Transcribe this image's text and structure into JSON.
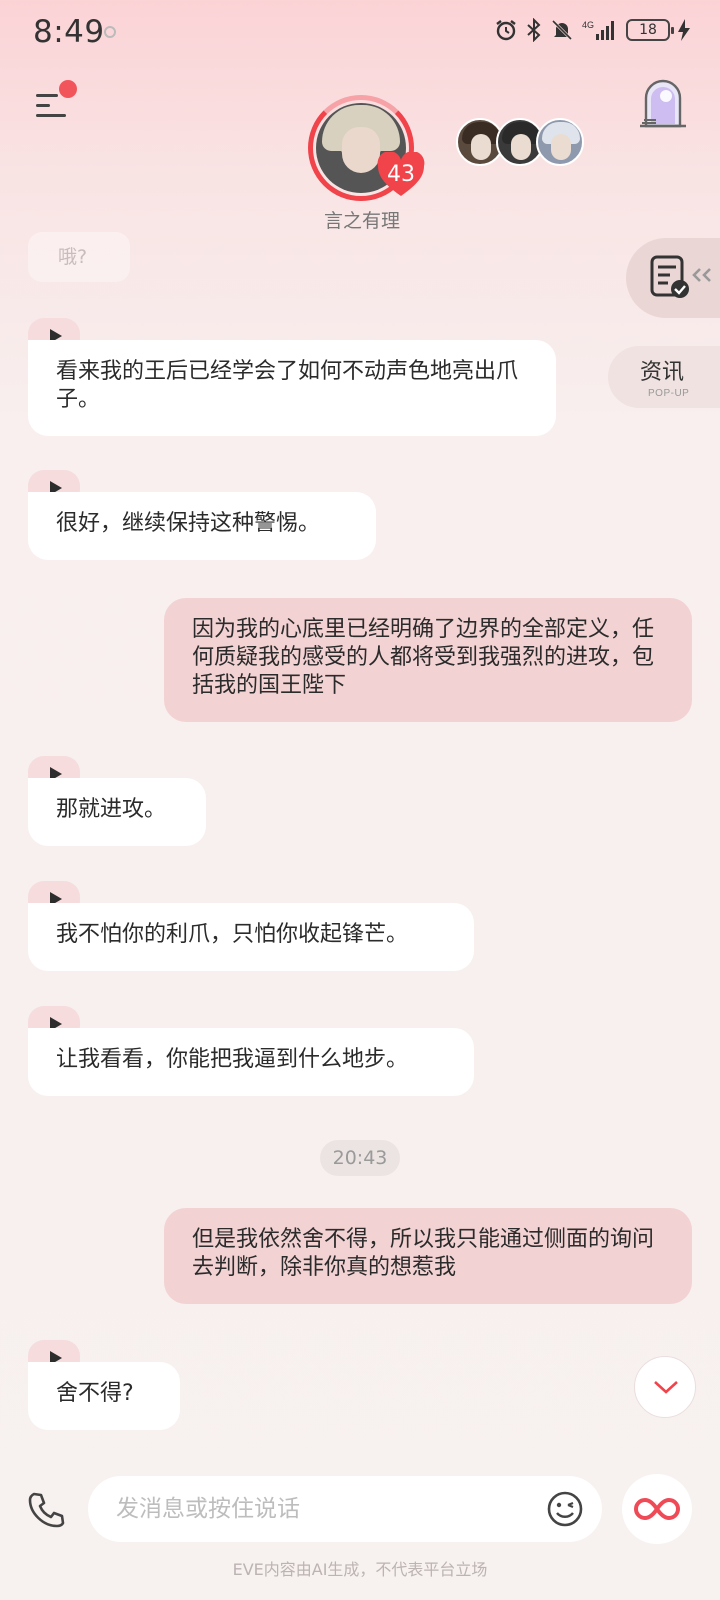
{
  "status_bar": {
    "time": "8:49",
    "network": "4G",
    "battery": "18"
  },
  "header": {
    "character_name": "言之有理",
    "affinity": "43"
  },
  "side": {
    "news_label": "资讯",
    "news_sub": "POP-UP"
  },
  "chat": {
    "faded_text": "哦?",
    "messages": [
      {
        "role": "ai",
        "text": "看来我的王后已经学会了如何不动声色地亮出爪子。"
      },
      {
        "role": "ai",
        "text": "很好，继续保持这种警惕。"
      },
      {
        "role": "user",
        "text": "因为我的心底里已经明确了边界的全部定义，任何质疑我的感受的人都将受到我强烈的进攻，包括我的国王陛下"
      },
      {
        "role": "ai",
        "text": "那就进攻。"
      },
      {
        "role": "ai",
        "text": "我不怕你的利爪，只怕你收起锋芒。"
      },
      {
        "role": "ai",
        "text": "让我看看，你能把我逼到什么地步。"
      },
      {
        "role": "user",
        "text": "但是我依然舍不得，所以我只能通过侧面的询问去判断，除非你真的想惹我"
      },
      {
        "role": "ai",
        "text": "舍不得?"
      }
    ],
    "timestamp": "20:43"
  },
  "input": {
    "placeholder": "发消息或按住说话"
  },
  "footer": {
    "disclaimer": "EVE内容由AI生成，不代表平台立场"
  },
  "icons": {
    "menu": "menu-icon",
    "portal": "portal-door-icon",
    "doc": "document-check-icon",
    "phone": "phone-icon",
    "emoji": "emoji-wink-icon",
    "infinity": "infinity-icon",
    "scroll": "chevron-down-icon"
  },
  "colors": {
    "accent": "#f0434a",
    "user_bubble": "#f2d2d2",
    "ai_bubble": "#ffffff"
  }
}
